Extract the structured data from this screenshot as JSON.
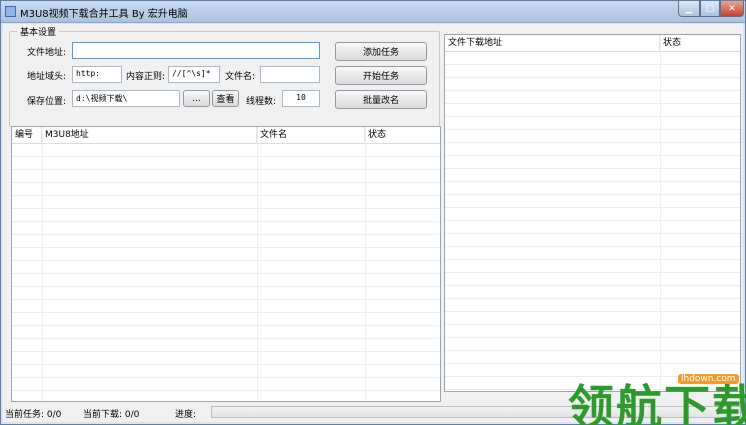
{
  "window": {
    "title": "M3U8视频下载合并工具 By 宏升电脑"
  },
  "settings": {
    "group_title": "基本设置",
    "file_address_label": "文件地址:",
    "file_address_value": "",
    "address_prefix_label": "地址域头:",
    "address_prefix_value": "http:",
    "content_regex_label": "内容正则:",
    "content_regex_value": "//[^\\s]*",
    "filename_label": "文件名:",
    "filename_value": "",
    "save_location_label": "保存位置:",
    "save_location_value": "d:\\视频下载\\",
    "browse_label": "...",
    "view_label": "查看",
    "threads_label": "线程数:",
    "threads_value": "10"
  },
  "actions": {
    "add_task": "添加任务",
    "start_task": "开始任务",
    "batch_rename": "批量改名"
  },
  "task_table": {
    "columns": [
      "编号",
      "M3U8地址",
      "文件名",
      "状态"
    ],
    "rows": []
  },
  "download_table": {
    "columns": [
      "文件下载地址",
      "状态"
    ],
    "rows": []
  },
  "statusbar": {
    "current_tasks": "当前任务: 0/0",
    "current_downloads": "当前下载: 0/0",
    "progress_label": "进度:",
    "progress": 0
  },
  "watermark": {
    "text": "领航下载",
    "url": "lhdown.com"
  },
  "colors": {
    "title_gradient": "#a9c3e0",
    "close_button": "#c5412a",
    "watermark": "#2e9a2e",
    "watermark_badge": "#f39b2a"
  }
}
